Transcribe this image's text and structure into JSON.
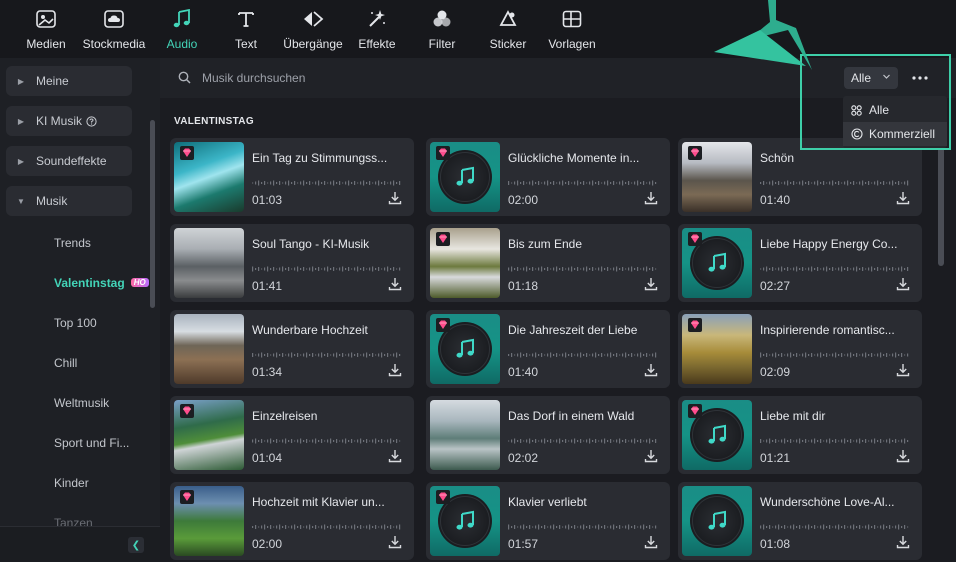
{
  "toolbar": {
    "items": [
      {
        "label": "Medien",
        "icon": "media-icon"
      },
      {
        "label": "Stockmedia",
        "icon": "cloud-icon"
      },
      {
        "label": "Audio",
        "icon": "music-note-icon",
        "active": true
      },
      {
        "label": "Text",
        "icon": "text-icon"
      },
      {
        "label": "Übergänge",
        "icon": "transition-icon"
      },
      {
        "label": "Effekte",
        "icon": "effects-icon"
      },
      {
        "label": "Filter",
        "icon": "filter-icon"
      },
      {
        "label": "Sticker",
        "icon": "sticker-icon"
      },
      {
        "label": "Vorlagen",
        "icon": "templates-icon"
      }
    ]
  },
  "sidebar": {
    "categories": [
      {
        "label": "Meine",
        "expanded": false
      },
      {
        "label": "KI Musik",
        "expanded": false
      },
      {
        "label": "Soundeffekte",
        "expanded": false
      },
      {
        "label": "Musik",
        "expanded": true
      }
    ],
    "subitems": [
      {
        "label": "Trends"
      },
      {
        "label": "Valentinstag",
        "active": true,
        "badge": "HO"
      },
      {
        "label": "Top 100"
      },
      {
        "label": "Chill"
      },
      {
        "label": "Weltmusik"
      },
      {
        "label": "Sport und Fi..."
      },
      {
        "label": "Kinder"
      },
      {
        "label": "Tanzen"
      }
    ]
  },
  "search": {
    "placeholder": "Musik durchsuchen"
  },
  "filter": {
    "selected": "Alle",
    "options": [
      "Alle",
      "Kommerziell"
    ]
  },
  "section_title": "VALENTINSTAG",
  "tracks": [
    {
      "title": "Ein Tag zu Stimmungss...",
      "duration": "01:03",
      "thumb": "waterfall",
      "premium": true
    },
    {
      "title": "Glückliche Momente in...",
      "duration": "02:00",
      "thumb": "disc",
      "premium": true
    },
    {
      "title": "Schön",
      "duration": "01:40",
      "thumb": "moor",
      "premium": true
    },
    {
      "title": "Soul Tango - KI-Musik",
      "duration": "01:41",
      "thumb": "lake",
      "premium": false
    },
    {
      "title": "Bis zum Ende",
      "duration": "01:18",
      "thumb": "stream",
      "premium": true
    },
    {
      "title": "Liebe Happy Energy Co...",
      "duration": "02:27",
      "thumb": "disc",
      "premium": true
    },
    {
      "title": "Wunderbare Hochzeit",
      "duration": "01:34",
      "thumb": "shore",
      "premium": false
    },
    {
      "title": "Die Jahreszeit der Liebe",
      "duration": "01:40",
      "thumb": "disc",
      "premium": true
    },
    {
      "title": "Inspirierende romantisc...",
      "duration": "02:09",
      "thumb": "valley",
      "premium": true
    },
    {
      "title": "Einzelreisen",
      "duration": "01:04",
      "thumb": "road",
      "premium": true
    },
    {
      "title": "Das Dorf in einem Wald",
      "duration": "02:02",
      "thumb": "misty",
      "premium": false
    },
    {
      "title": "Liebe mit dir",
      "duration": "01:21",
      "thumb": "disc",
      "premium": true
    },
    {
      "title": "Hochzeit mit Klavier un...",
      "duration": "02:00",
      "thumb": "hills",
      "premium": true
    },
    {
      "title": "Klavier verliebt",
      "duration": "01:57",
      "thumb": "disc",
      "premium": true
    },
    {
      "title": "Wunderschöne Love-Al...",
      "duration": "01:08",
      "thumb": "disc",
      "premium": false
    }
  ],
  "colors": {
    "accent": "#43d4b8",
    "highlight": "#3ecfa9",
    "background": "#17181c",
    "card": "#2a2c32"
  }
}
